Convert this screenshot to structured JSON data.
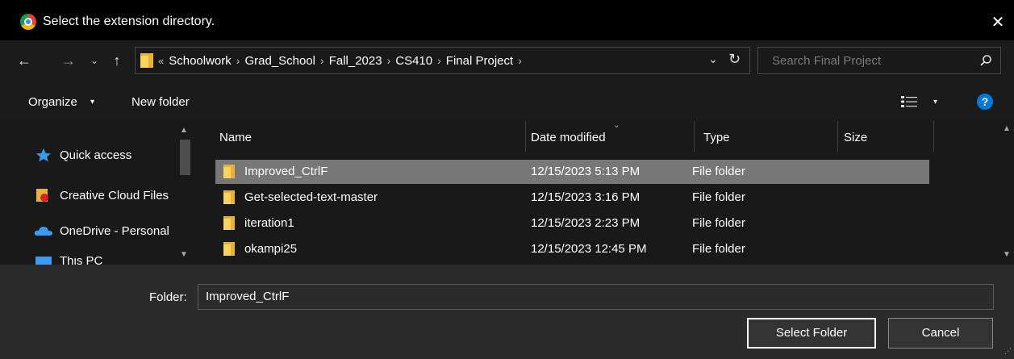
{
  "window": {
    "title": "Select the extension directory.",
    "close_glyph": "✕"
  },
  "nav": {
    "back": "←",
    "forward": "→",
    "recent": "⌄",
    "up": "↑"
  },
  "address": {
    "lead": "«",
    "crumbs": [
      "Schoolwork",
      "Grad_School",
      "Fall_2023",
      "CS410",
      "Final Project"
    ],
    "separator": "›",
    "dropdown": "⌄",
    "refresh": "↻"
  },
  "search": {
    "placeholder": "Search Final Project"
  },
  "toolbar": {
    "organize_label": "Organize",
    "organize_caret": "▾",
    "new_folder_label": "New folder",
    "view_caret": "▾",
    "help_glyph": "?"
  },
  "sidebar": {
    "items": [
      {
        "label": "Quick access",
        "icon": "star-icon"
      },
      {
        "label": "Creative Cloud Files",
        "icon": "creative-cloud-icon"
      },
      {
        "label": "OneDrive - Personal",
        "icon": "onedrive-icon"
      },
      {
        "label": "This PC",
        "icon": "computer-icon"
      }
    ]
  },
  "columns": {
    "name": "Name",
    "date": "Date modified",
    "type": "Type",
    "size": "Size"
  },
  "files": [
    {
      "name": "Improved_CtrlF",
      "date": "12/15/2023 5:13 PM",
      "type": "File folder",
      "selected": true
    },
    {
      "name": "Get-selected-text-master",
      "date": "12/15/2023 3:16 PM",
      "type": "File folder",
      "selected": false
    },
    {
      "name": "iteration1",
      "date": "12/15/2023 2:23 PM",
      "type": "File folder",
      "selected": false
    },
    {
      "name": "okampi25",
      "date": "12/15/2023 12:45 PM",
      "type": "File folder",
      "selected": false
    }
  ],
  "footer": {
    "folder_label": "Folder:",
    "folder_value": "Improved_CtrlF",
    "select_button": "Select Folder",
    "cancel_button": "Cancel"
  },
  "colors": {
    "accent": "#0078d7",
    "folder": "#e8b13b",
    "selected_row": "#777777",
    "background": "#191919"
  }
}
